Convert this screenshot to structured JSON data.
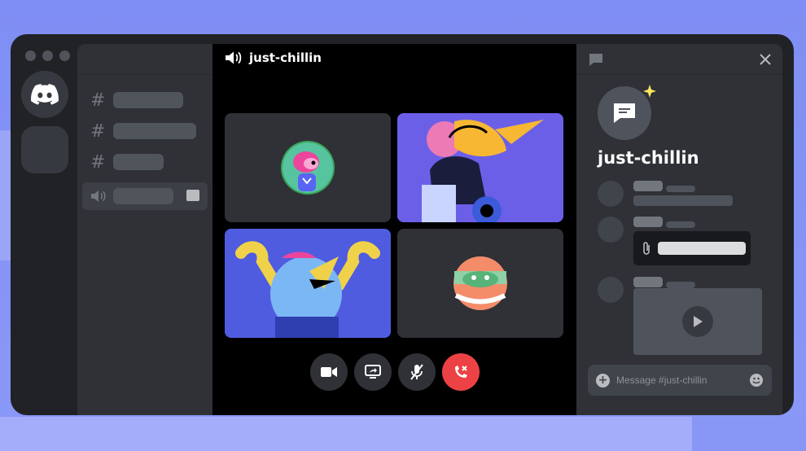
{
  "voice": {
    "channel_name": "just-chillin"
  },
  "panel": {
    "channel_title": "just-chillin",
    "message_placeholder": "Message #just-chillin"
  },
  "icons": {
    "discord_logo": "discord-logo-icon",
    "hash": "#",
    "speaker": "speaker-icon",
    "camera": "video-camera-icon",
    "screen_share": "screen-share-icon",
    "mute": "microphone-muted-icon",
    "hang_up": "phone-hangup-icon",
    "close": "close-icon",
    "chat": "chat-bubble-icon",
    "attachment": "paperclip-icon",
    "play": "play-icon",
    "add": "add-circle-icon",
    "emoji": "emoji-icon"
  },
  "colors": {
    "background": "#8190f5",
    "window": "#202225",
    "sidebar": "#2f3136",
    "voice_stage": "#000000",
    "accent": "#5865f2",
    "hangup": "#ed4245"
  }
}
